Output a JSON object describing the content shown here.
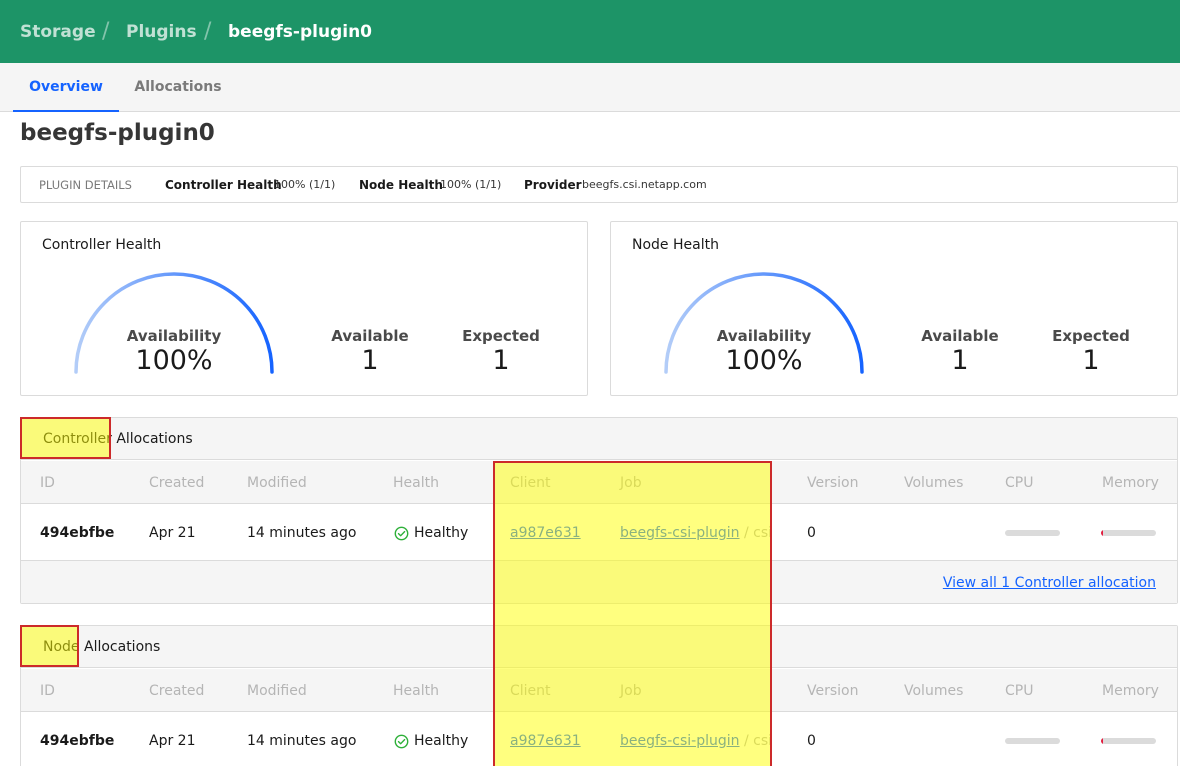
{
  "breadcrumb": {
    "storage": "Storage",
    "plugins": "Plugins",
    "current": "beegfs-plugin0",
    "separator": "/"
  },
  "tabs": [
    {
      "label": "Overview",
      "active": true
    },
    {
      "label": "Allocations",
      "active": false
    }
  ],
  "page_title": "beegfs-plugin0",
  "plugin_details": {
    "heading": "PLUGIN DETAILS",
    "controller_health_label": "Controller Health",
    "controller_health_value": "100% (1/1)",
    "node_health_label": "Node Health",
    "node_health_value": "100% (1/1)",
    "provider_label": "Provider",
    "provider_value": "beegfs.csi.netapp.com"
  },
  "health_cards": [
    {
      "title": "Controller Health",
      "gauge_label": "Availability",
      "gauge_value": "100%",
      "gauge_fraction": 1.0,
      "available_label": "Available",
      "available_value": "1",
      "expected_label": "Expected",
      "expected_value": "1"
    },
    {
      "title": "Node Health",
      "gauge_label": "Availability",
      "gauge_value": "100%",
      "gauge_fraction": 1.0,
      "available_label": "Available",
      "available_value": "1",
      "expected_label": "Expected",
      "expected_value": "1"
    }
  ],
  "columns": [
    "ID",
    "Created",
    "Modified",
    "Health",
    "Client",
    "Job",
    "Version",
    "Volumes",
    "CPU",
    "Memory"
  ],
  "controller_allocations": {
    "title_highlight": "Controller",
    "title_rest": " Allocations",
    "rows": [
      {
        "id": "494ebfbe",
        "created": "Apr 21",
        "modified": "14 minutes ago",
        "health": "Healthy",
        "client": "a987e631",
        "job": "beegfs-csi-plugin",
        "job_sep": " / ",
        "job_group": "csi",
        "version": "0",
        "volumes": "",
        "cpu_fraction": 0.0,
        "memory_fraction": 0.03
      }
    ],
    "view_all": "View all 1 Controller allocation"
  },
  "node_allocations": {
    "title_highlight": "Node",
    "title_rest": " Allocations",
    "rows": [
      {
        "id": "494ebfbe",
        "created": "Apr 21",
        "modified": "14 minutes ago",
        "health": "Healthy",
        "client": "a987e631",
        "job": "beegfs-csi-plugin",
        "job_sep": " / ",
        "job_group": "csi",
        "version": "0",
        "volumes": "",
        "cpu_fraction": 0.0,
        "memory_fraction": 0.03
      }
    ]
  },
  "colors": {
    "brand": "#1d9467",
    "link": "#1563ff",
    "healthy": "#2eb039",
    "memory_bar": "#e31d3f",
    "highlight": "#ffff00",
    "highlight_border": "#cc2a2a"
  },
  "icons": {
    "healthy": "check-circle-icon"
  }
}
